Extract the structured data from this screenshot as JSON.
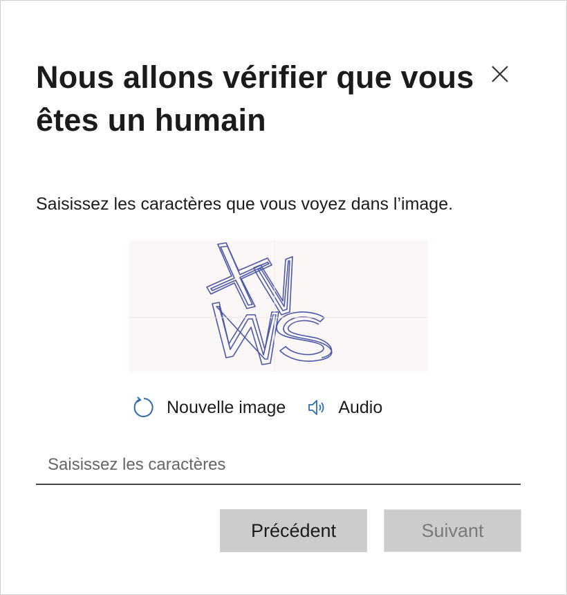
{
  "dialog": {
    "title": "Nous allons vérifier que vous êtes un humain",
    "close_icon": "close-icon",
    "instruction": "Saisissez les caractères que vous voyez dans l’image.",
    "captcha": {
      "new_image_label": "Nouvelle image",
      "new_image_icon": "refresh-icon",
      "audio_label": "Audio",
      "audio_icon": "speaker-icon",
      "icon_color": "#2b6cb0"
    },
    "input": {
      "value": "",
      "placeholder": "Saisissez les caractères"
    },
    "buttons": {
      "previous_label": "Précédent",
      "next_label": "Suivant"
    }
  }
}
